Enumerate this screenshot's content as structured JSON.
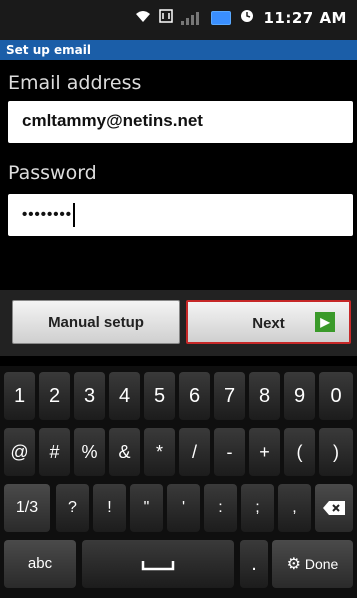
{
  "status_bar": {
    "time": "11:27 AM"
  },
  "titlebar": {
    "title": "Set up email"
  },
  "email": {
    "label": "Email address",
    "value": "cmltammy@netins.net"
  },
  "password": {
    "label": "Password",
    "value": "••••••••"
  },
  "buttons": {
    "manual": "Manual setup",
    "next": "Next"
  },
  "keyboard": {
    "numbers": [
      "1",
      "2",
      "3",
      "4",
      "5",
      "6",
      "7",
      "8",
      "9",
      "0"
    ],
    "symbols1": [
      "@",
      "#",
      "%",
      "&",
      "*",
      "/",
      "-",
      "+",
      "(",
      ")"
    ],
    "symbols2": [
      "1/3",
      "?",
      "!",
      "\"",
      "'",
      ":",
      ";",
      ","
    ],
    "bottom": {
      "abc": "abc",
      "dot": ".",
      "done": "Done"
    }
  }
}
